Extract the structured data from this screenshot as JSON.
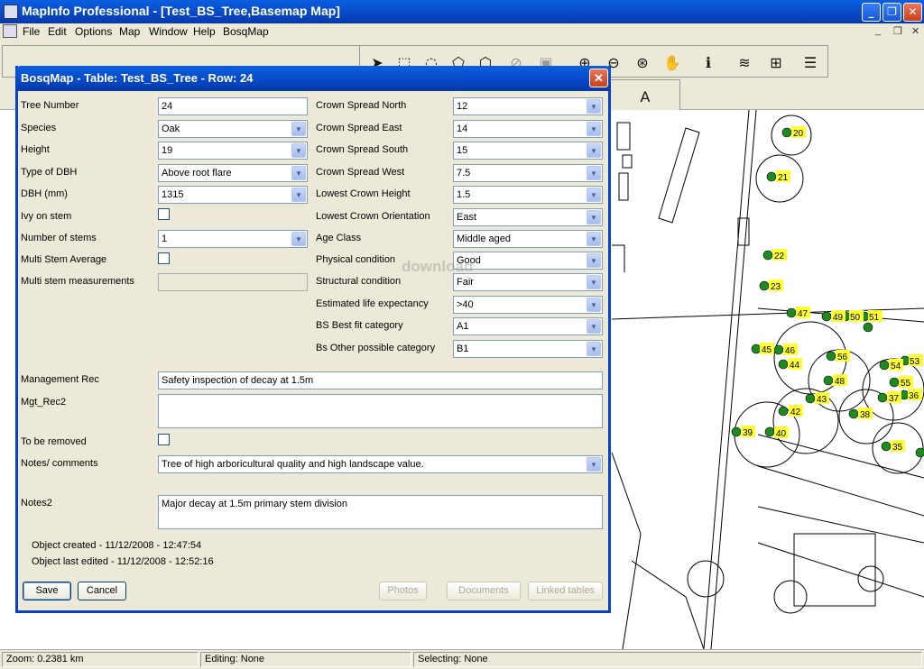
{
  "window": {
    "title": "MapInfo Professional - [Test_BS_Tree,Basemap Map]"
  },
  "menu": {
    "items": [
      "File",
      "Edit",
      "Options",
      "Map",
      "Window",
      "Help",
      "BosqMap"
    ]
  },
  "dialog": {
    "title": "BosqMap - Table: Test_BS_Tree - Row: 24",
    "left": [
      {
        "label": "Tree Number",
        "value": "24",
        "type": "text"
      },
      {
        "label": "Species",
        "value": "Oak",
        "type": "combo"
      },
      {
        "label": "Height",
        "value": "19",
        "type": "combo"
      },
      {
        "label": "Type of DBH",
        "value": "Above root flare",
        "type": "combo"
      },
      {
        "label": "DBH (mm)",
        "value": "1315",
        "type": "combo"
      },
      {
        "label": "Ivy on stem",
        "value": "",
        "type": "check"
      },
      {
        "label": "Number of stems",
        "value": "1",
        "type": "combo"
      },
      {
        "label": "Multi Stem Average",
        "value": "",
        "type": "check"
      },
      {
        "label": "Multi stem measurements",
        "value": "",
        "type": "disabled"
      }
    ],
    "right": [
      {
        "label": "Crown Spread North",
        "value": "12"
      },
      {
        "label": "Crown Spread East",
        "value": "14"
      },
      {
        "label": "Crown Spread South",
        "value": "15"
      },
      {
        "label": "Crown Spread West",
        "value": "7.5"
      },
      {
        "label": "Lowest Crown Height",
        "value": "1.5"
      },
      {
        "label": "Lowest Crown Orientation",
        "value": "East"
      },
      {
        "label": "Age Class",
        "value": "Middle aged"
      },
      {
        "label": "Physical condition",
        "value": "Good"
      },
      {
        "label": "Structural condition",
        "value": "Fair"
      },
      {
        "label": "Estimated life expectancy",
        "value": ">40"
      },
      {
        "label": "BS Best fit category",
        "value": "A1"
      },
      {
        "label": "Bs Other possible category",
        "value": "B1"
      }
    ],
    "management_rec": {
      "label": "Management Rec",
      "value": "Safety inspection of decay at 1.5m"
    },
    "mgt_rec2": {
      "label": "Mgt_Rec2",
      "value": ""
    },
    "to_be_removed": {
      "label": "To be removed"
    },
    "notes": {
      "label": "Notes/ comments",
      "value": "Tree of high arboricultural quality and high landscape value."
    },
    "notes2": {
      "label": "Notes2",
      "value": "Major decay at 1.5m primary  stem division"
    },
    "created": "Object created - 11/12/2008 - 12:47:54",
    "edited": "Object last edited - 11/12/2008 - 12:52:16",
    "buttons": {
      "save": "Save",
      "cancel": "Cancel",
      "photos": "Photos",
      "documents": "Documents",
      "linked": "Linked tables"
    }
  },
  "watermark": "download",
  "map": {
    "tree_labels": [
      "20",
      "21",
      "22",
      "23",
      "47",
      "49",
      "50",
      "51",
      "45",
      "46",
      "44",
      "56",
      "54",
      "53",
      "48",
      "55",
      "37",
      "36",
      "43",
      "42",
      "38",
      "39",
      "40",
      "35"
    ]
  },
  "status": {
    "zoom": "Zoom: 0.2381 km",
    "editing": "Editing: None",
    "selecting": "Selecting: None"
  },
  "colors": {
    "titlebar": "#0847c4",
    "tree_dot": "#1f8a1f",
    "label_bg": "#ffff33"
  }
}
